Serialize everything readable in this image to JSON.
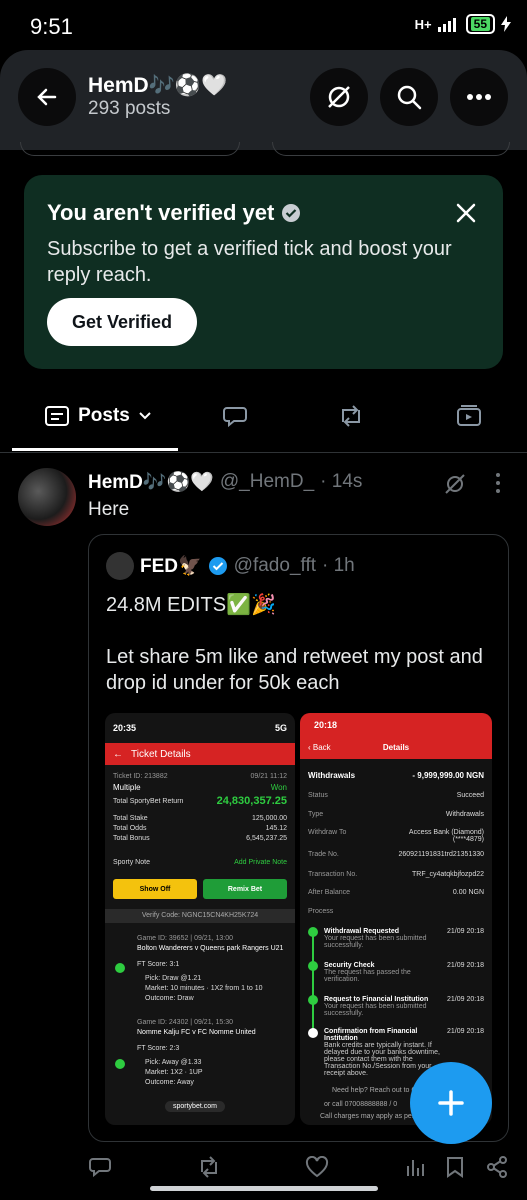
{
  "status": {
    "time": "9:51",
    "network": "H+",
    "battery": "55"
  },
  "header": {
    "name": "HemD🎶⚽🤍",
    "posts": "293 posts"
  },
  "verify_card": {
    "title": "You aren't verified yet",
    "subtitle": "Subscribe to get a verified tick and boost your reply reach.",
    "button": "Get Verified"
  },
  "tabs": {
    "active": "Posts"
  },
  "post": {
    "name": "HemD🎶⚽🤍",
    "handle": "@_HemD_",
    "time": "· 14s",
    "text": "Here",
    "quote": {
      "name": "FED🦅",
      "handle": "@fado_fft",
      "time": "· 1h",
      "lines": [
        "24.8M EDITS✅🎉",
        "",
        "Let share 5m like and retweet my post and drop id under for 50k each"
      ]
    }
  },
  "shot1": {
    "time": "20:35",
    "signal": "5G",
    "title": "Ticket Details",
    "ticket_id": "Ticket ID: 213882",
    "date": "09/21 11:12",
    "type": "Multiple",
    "won": "Won",
    "return_label": "Total SportyBet Return",
    "return_value": "24,830,357.25",
    "stake_label": "Total Stake",
    "stake_value": "125,000.00",
    "odds_label": "Total Odds",
    "odds_value": "145.12",
    "bonus_label": "Total Bonus",
    "bonus_value": "6,545,237.25",
    "note_label": "Sporty Note",
    "note_action": "Add Private Note",
    "show_off": "Show Off",
    "remix": "Remix Bet",
    "verify": "Verify Code: NGNC15CN4KH25K724",
    "game1_id": "Game ID: 39652 | 09/21, 13:00",
    "game1_teams": "Bolton Wanderers v Queens park Rangers U21",
    "game1_score": "FT Score: 3:1",
    "game1_pick": "Pick: Draw @1.21",
    "game1_market": "Market: 10 minutes · 1X2 from 1 to 10",
    "game1_outcome": "Outcome: Draw",
    "game2_id": "Game ID: 24302 | 09/21, 15:30",
    "game2_teams": "Nomme Kalju FC v FC Nomme United",
    "game2_score": "FT Score: 2:3",
    "game2_pick": "Pick: Away @1.33",
    "game2_market": "Market: 1X2 · 1UP",
    "game2_outcome": "Outcome: Away",
    "footer": "sportybet.com"
  },
  "shot2": {
    "time": "20:18",
    "back": "Back",
    "title": "Details",
    "withdrawals_label": "Withdrawals",
    "withdrawals_value": "- 9,999,999.00 NGN",
    "status_label": "Status",
    "status_value": "Succeed",
    "type_label": "Type",
    "type_value": "Withdrawals",
    "to_label": "Withdraw To",
    "to_value": "Access Bank (Diamond) (****4879)",
    "trade_label": "Trade No.",
    "trade_value": "260921191831trd21351330",
    "txn_label": "Transaction No.",
    "txn_value": "TRF_cy4atqkbjfozpd22",
    "balance_label": "After Balance",
    "balance_value": "0.00 NGN",
    "process_label": "Process",
    "steps": [
      {
        "title": "Withdrawal Requested",
        "desc": "Your request has been submitted successfully.",
        "date": "21/09 20:18"
      },
      {
        "title": "Security Check",
        "desc": "The request has passed the verification.",
        "date": "21/09 20:18"
      },
      {
        "title": "Request to Financial Institution",
        "desc": "Your request has been submitted successfully.",
        "date": "21/09 20:18"
      },
      {
        "title": "Confirmation from Financial Institution",
        "desc": "Bank credits are typically instant. If delayed due to your banks downtime, please contact them with the Transaction No./Session from your receipt above.",
        "date": "21/09 20:18"
      }
    ],
    "help": "Need help? Reach out to C",
    "call": "or call 07008888888 / 0",
    "charges": "Call charges may apply as per y"
  }
}
